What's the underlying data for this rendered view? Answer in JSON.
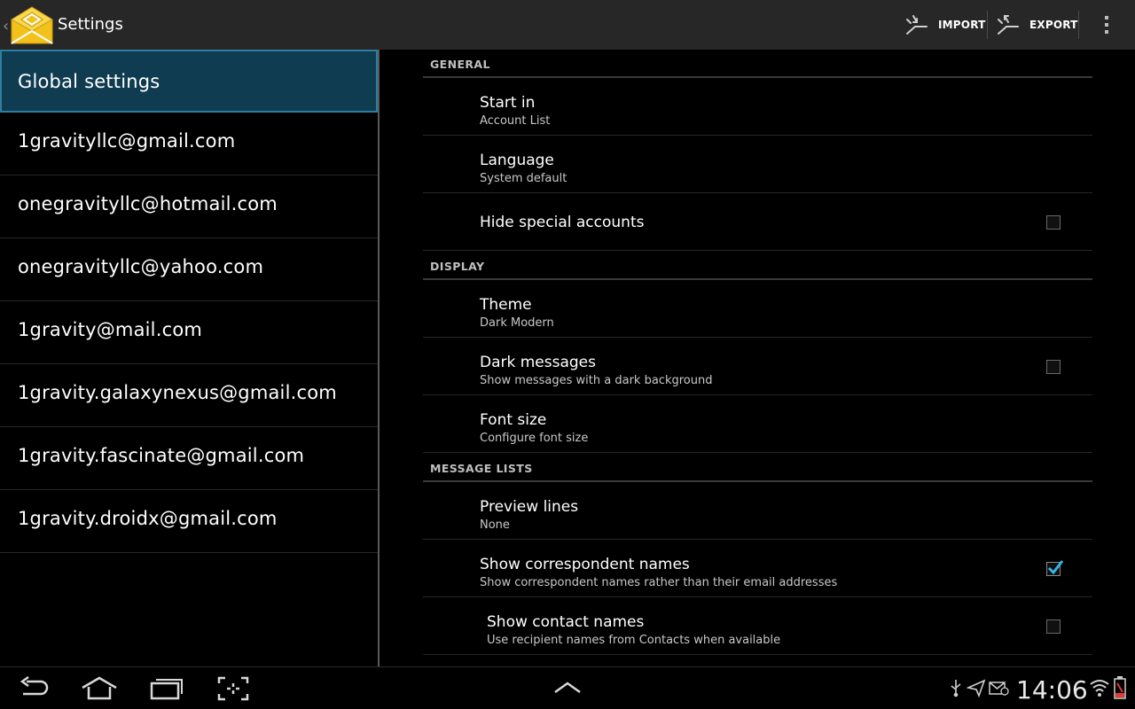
{
  "action_bar": {
    "up_glyph": "‹",
    "title": "Settings",
    "import_label": "IMPORT",
    "export_label": "EXPORT",
    "logo_icon": "envelope-logo",
    "overflow_icon": "overflow-menu-icon"
  },
  "sidebar": {
    "items": [
      {
        "label": "Global settings",
        "selected": true
      },
      {
        "label": "1gravityllc@gmail.com"
      },
      {
        "label": "onegravityllc@hotmail.com"
      },
      {
        "label": "onegravityllc@yahoo.com"
      },
      {
        "label": "1gravity@mail.com"
      },
      {
        "label": "1gravity.galaxynexus@gmail.com"
      },
      {
        "label": "1gravity.fascinate@gmail.com"
      },
      {
        "label": "1gravity.droidx@gmail.com"
      }
    ]
  },
  "settings": {
    "general": {
      "header": "GENERAL",
      "start_in": {
        "title": "Start in",
        "summary": "Account List"
      },
      "language": {
        "title": "Language",
        "summary": "System default"
      },
      "hide_special": {
        "title": "Hide special accounts",
        "checked": false
      }
    },
    "display": {
      "header": "DISPLAY",
      "theme": {
        "title": "Theme",
        "summary": "Dark Modern"
      },
      "dark_messages": {
        "title": "Dark messages",
        "summary": "Show messages with a dark background",
        "checked": false
      },
      "font_size": {
        "title": "Font size",
        "summary": "Configure font size"
      }
    },
    "message_lists": {
      "header": "MESSAGE LISTS",
      "preview_lines": {
        "title": "Preview lines",
        "summary": "None"
      },
      "correspondent_names": {
        "title": "Show correspondent names",
        "summary": "Show correspondent names rather than their email addresses",
        "checked": true
      },
      "contact_names": {
        "title": "Show contact names",
        "summary": "Use recipient names from Contacts when available",
        "checked": false
      }
    }
  },
  "status_bar": {
    "time": "14:06"
  },
  "colors": {
    "accent": "#33b5e5",
    "selected_bg": "#0f3c50",
    "battery_charging": "#e53935"
  }
}
